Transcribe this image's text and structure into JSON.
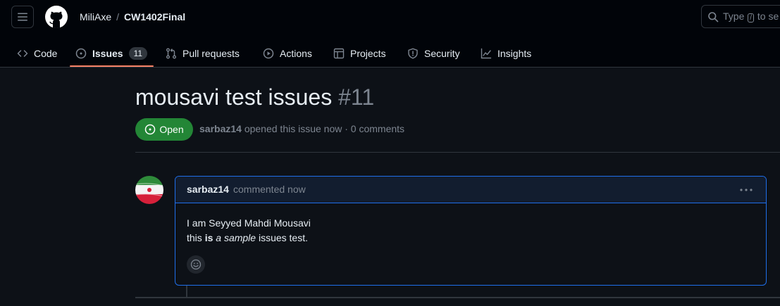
{
  "header": {
    "owner": "MiliAxe",
    "separator": "/",
    "repo": "CW1402Final",
    "search": {
      "prefix": "Type",
      "key": "/",
      "suffix": "to se"
    }
  },
  "tabs": [
    {
      "label": "Code",
      "icon": "code-icon"
    },
    {
      "label": "Issues",
      "icon": "issue-opened-icon",
      "count": "11",
      "active": true
    },
    {
      "label": "Pull requests",
      "icon": "git-pull-request-icon"
    },
    {
      "label": "Actions",
      "icon": "play-icon"
    },
    {
      "label": "Projects",
      "icon": "table-icon"
    },
    {
      "label": "Security",
      "icon": "shield-icon"
    },
    {
      "label": "Insights",
      "icon": "graph-icon"
    }
  ],
  "issue": {
    "title": "mousavi test issues",
    "number": "#11",
    "state": "Open",
    "author": "sarbaz14",
    "meta_text": "opened this issue now · 0 comments"
  },
  "comment": {
    "author": "sarbaz14",
    "time": "commented now",
    "line1": "I am Seyyed Mahdi Mousavi",
    "line2_pre": "this",
    "line2_bold": "is",
    "line2_italic": "a sample",
    "line2_post": "issues test."
  },
  "colors": {
    "background": "#0d1117",
    "header_bg": "#010409",
    "open_green": "#238636",
    "accent_blue": "#1f6feb",
    "tab_underline": "#f78166"
  }
}
